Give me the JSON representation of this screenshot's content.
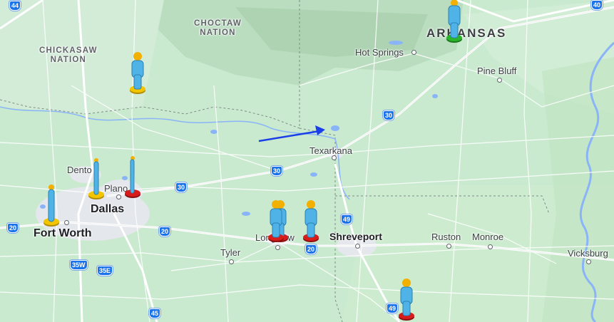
{
  "map": {
    "regions": [
      {
        "id": "choctaw",
        "lines": [
          "CHOCTAW",
          "NATION"
        ]
      },
      {
        "id": "chickasaw",
        "lines": [
          "CHICKASAW",
          "NATION"
        ]
      }
    ],
    "state_label": "ARKANSAS",
    "cities": {
      "hot_springs": "Hot Springs",
      "pine_bluff": "Pine Bluff",
      "texarkana": "Texarkana",
      "denton": "Dento",
      "plano": "Plano",
      "dallas": "Dallas",
      "fort_worth": "Fort Worth",
      "longview": "Longview",
      "tyler": "Tyler",
      "shreveport": "Shreveport",
      "ruston": "Ruston",
      "monroe": "Monroe",
      "vicksburg": "Vicksburg"
    },
    "shields": {
      "i44": "44",
      "i40": "40",
      "i30a": "30",
      "i30b": "30",
      "i30c": "30",
      "i20a": "20",
      "i20b": "20",
      "i20c": "20",
      "i49a": "49",
      "i49b": "49",
      "i35w": "35W",
      "i35e": "35E",
      "i45": "45"
    },
    "colors": {
      "land": "#c5e8cd",
      "water": "#8ab4f8",
      "road": "#ffffff",
      "interstate_shield": "#1a73e8",
      "arrow": "#1a3ee8",
      "pin_body": "#4fb3e8",
      "pin_head": "#f2b000"
    },
    "pegman_markers": [
      {
        "id": "marker-oklahoma",
        "base_color": "#f2c500",
        "style": "standing"
      },
      {
        "id": "marker-arkansas",
        "base_color": "#2bb42b",
        "style": "standing"
      },
      {
        "id": "marker-denton",
        "base_color": "#f2c500",
        "style": "thin"
      },
      {
        "id": "marker-plano",
        "base_color": "#d81b1b",
        "style": "thin"
      },
      {
        "id": "marker-fort-worth",
        "base_color": "#f2c500",
        "style": "thin"
      },
      {
        "id": "marker-longview-1",
        "base_color": "#d81b1b",
        "style": "standing"
      },
      {
        "id": "marker-longview-2",
        "base_color": "#d81b1b",
        "style": "standing"
      },
      {
        "id": "marker-longview-3",
        "base_color": "#d81b1b",
        "style": "standing"
      },
      {
        "id": "marker-louisiana",
        "base_color": "#d81b1b",
        "style": "standing"
      }
    ]
  }
}
